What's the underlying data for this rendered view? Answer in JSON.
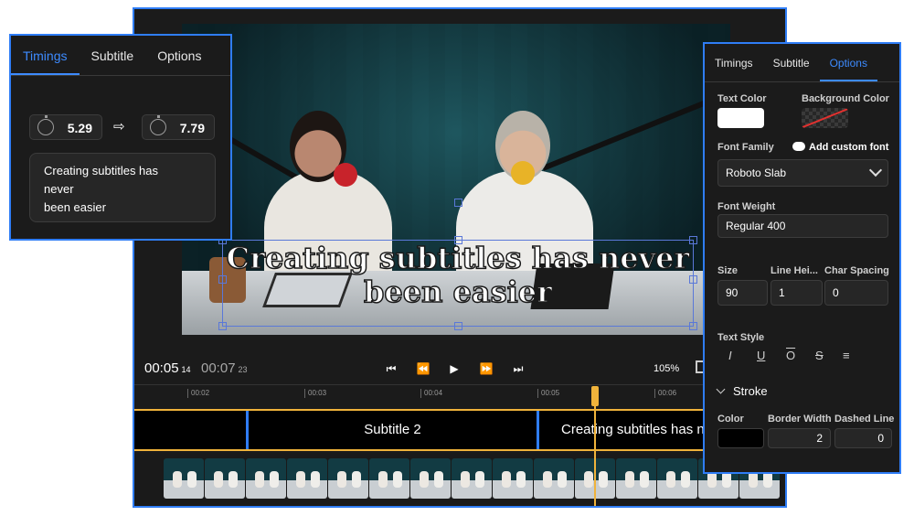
{
  "preview": {
    "overlay_line1": "Creating subtitles has never",
    "overlay_line2": "been easier"
  },
  "player": {
    "current_time": "00:05",
    "current_frame": "14",
    "total_time": "00:07",
    "total_frame": "23",
    "zoom": "105%"
  },
  "ruler": {
    "ticks": [
      "00:02",
      "00:03",
      "00:04",
      "00:05",
      "00:06"
    ]
  },
  "timeline": {
    "clips": [
      "",
      "Subtitle 2",
      "Creating subtitles has never been easier"
    ]
  },
  "left_panel": {
    "tabs": [
      "Timings",
      "Subtitle",
      "Options"
    ],
    "active_tab": "Timings",
    "start_time": "5.29",
    "end_time": "7.79",
    "subtitle_text": "Creating subtitles has\nnever\nbeen easier"
  },
  "right_panel": {
    "tabs": [
      "Timings",
      "Subtitle",
      "Options"
    ],
    "active_tab": "Options",
    "text_color_label": "Text Color",
    "background_color_label": "Background Color",
    "text_color": "#ffffff",
    "font_family_label": "Font Family",
    "add_custom_font": "Add custom font",
    "font_family_value": "Roboto Slab",
    "font_weight_label": "Font Weight",
    "font_weight_value": "Regular 400",
    "size_label": "Size",
    "line_height_label": "Line Hei...",
    "char_spacing_label": "Char Spacing",
    "size_value": "90",
    "line_height_value": "1",
    "char_spacing_value": "0",
    "text_style_label": "Text Style",
    "stroke_label": "Stroke",
    "stroke_color_label": "Color",
    "border_width_label": "Border Width",
    "dashed_line_label": "Dashed Line",
    "stroke_color": "#000000",
    "border_width_value": "2",
    "dashed_line_value": "0"
  },
  "colors": {
    "accent": "#2f7df6",
    "timeline_highlight": "#f0b33b"
  }
}
